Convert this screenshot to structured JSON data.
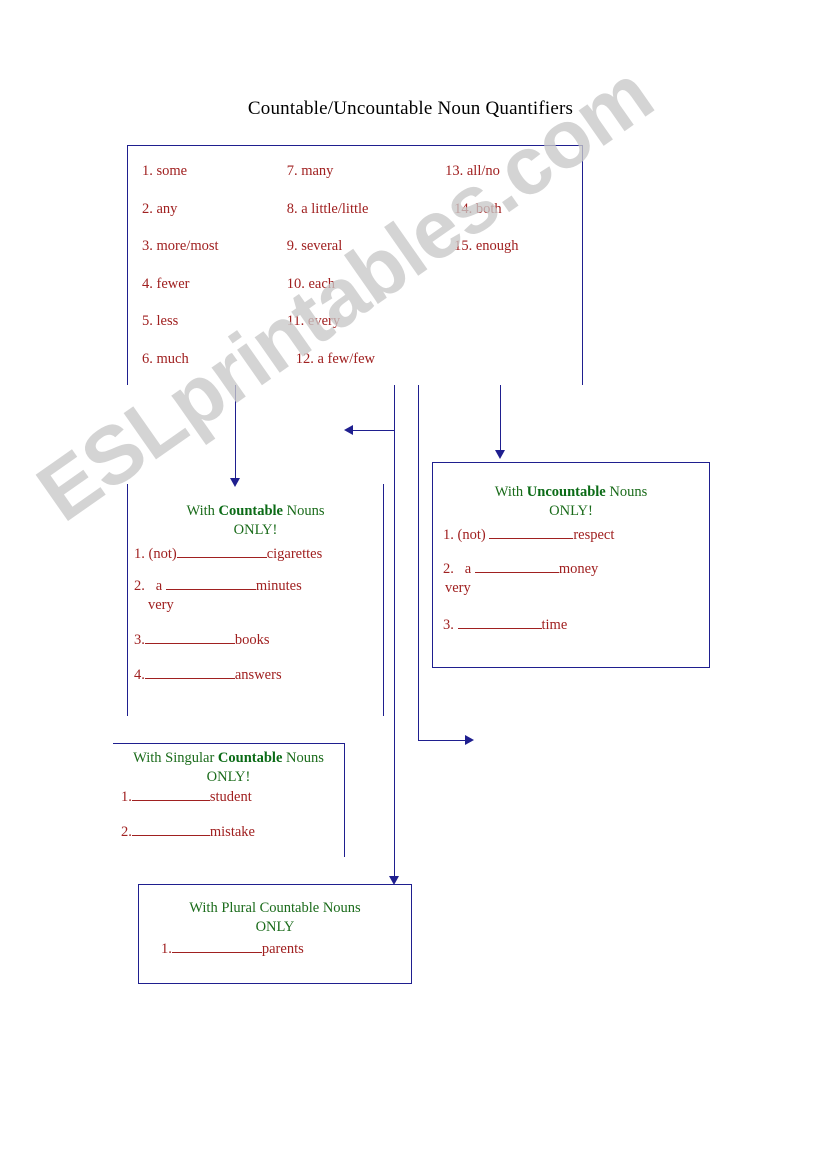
{
  "page": {
    "title": "Countable/Uncountable Noun Quantifiers",
    "watermark": "ESLprintables.com",
    "colors": {
      "line": "#1f1f8f",
      "quantifier_text": "#a02020",
      "heading_text": "#1a6b1a",
      "title_text": "#000000",
      "watermark": "#c9c9c9"
    }
  },
  "quantifier_bank": {
    "columns": [
      {
        "items": [
          "1. some",
          "2. any",
          "3. more/most",
          "4. fewer",
          "5. less",
          "6. much"
        ]
      },
      {
        "items": [
          "7. many",
          "8. a little/little",
          "9. several",
          "10. each",
          "11. every",
          "12. a few/few"
        ]
      },
      {
        "items": [
          "13. all/no",
          "14. both",
          "15. enough"
        ]
      }
    ]
  },
  "countable_box": {
    "heading_prefix": "With ",
    "heading_bold": "Countable",
    "heading_suffix": " Nouns",
    "heading_only": "ONLY!",
    "items": [
      {
        "number": "1.",
        "pre": "(not)",
        "post": "cigarettes",
        "extra": ""
      },
      {
        "number": "2.",
        "pre": "a",
        "post": "minutes",
        "extra": "very"
      },
      {
        "number": "3.",
        "pre": "",
        "post": "books",
        "extra": ""
      },
      {
        "number": "4.",
        "pre": "",
        "post": "answers",
        "extra": ""
      }
    ]
  },
  "uncountable_box": {
    "heading_prefix": "With ",
    "heading_bold": "Uncountable",
    "heading_suffix": " Nouns",
    "heading_only": "ONLY!",
    "items": [
      {
        "number": "1.",
        "pre": "(not)",
        "post": "respect",
        "extra": ""
      },
      {
        "number": "2.",
        "pre": "a",
        "post": "money",
        "extra": "very"
      },
      {
        "number": "3.",
        "pre": "",
        "post": "time",
        "extra": ""
      }
    ]
  },
  "singular_countable_box": {
    "heading_prefix": "With Singular ",
    "heading_bold": "Countable",
    "heading_suffix": " Nouns",
    "heading_only": "ONLY!",
    "items": [
      {
        "number": "1.",
        "pre": "",
        "post": "student",
        "extra": ""
      },
      {
        "number": "2.",
        "pre": "",
        "post": "mistake",
        "extra": ""
      }
    ]
  },
  "plural_countable_box": {
    "heading_prefix": "With Plural Countable",
    "heading_bold": "",
    "heading_suffix": " Nouns",
    "heading_only": "ONLY",
    "items": [
      {
        "number": "1.",
        "pre": "",
        "post": "parents",
        "extra": ""
      }
    ]
  }
}
